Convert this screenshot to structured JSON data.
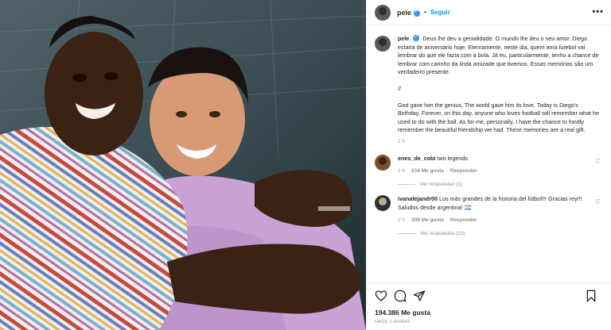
{
  "post": {
    "header": {
      "username": "pele",
      "separator": "•",
      "follow_label": "Seguir",
      "more_label": "•••"
    },
    "caption": {
      "username": "pele",
      "paragraph_pt": "Deus lhe deu a genialidade. O mundo lhe deu o seu amor. Diego estaria de aniversário hoje. Eternamente, neste dia, quem ama futebol vai lembrar do que ele fazia com a bola. Já eu, particularmente, tenho a chance de lembrar com carinho da linda amizade que tivemos. Essas memórias são um verdadeiro presente.",
      "divider": "//",
      "paragraph_en": "God gave him the genius. The world gave him its love. Today is Diego's Birthday. Forever, on this day, anyone who loves football will remember what he used to do with the ball. As for me, personally, I have the chance to fondly remember the beautiful friendship we had. These memories are a real gift.",
      "time": "2 h"
    },
    "comments": [
      {
        "username": "enes_de_colo",
        "text": "two legends.",
        "time": "2 h",
        "likes": "234 Me gusta",
        "reply": "Responder",
        "view_replies": "Ver respuestas (1)"
      },
      {
        "username": "ivanalejandr00",
        "text": "Los más grandes de la historia del fútbol!!! Gracias rey!!! Saludos desde argentina! 🇦🇷",
        "time": "2 h",
        "likes": "309 Me gusta",
        "reply": "Responder",
        "view_replies": "Ver respuestas (22)"
      }
    ],
    "likes_count": "194.386 Me gusta",
    "posted_ago": "HACE 2 HORAS"
  },
  "icons": [
    "heart-icon",
    "comment-icon",
    "share-icon",
    "bookmark-icon",
    "verified-badge-icon",
    "more-options-icon"
  ],
  "colors": {
    "accent": "#0095f6",
    "verified": "#3897f0",
    "muted": "#8e8e8e"
  }
}
